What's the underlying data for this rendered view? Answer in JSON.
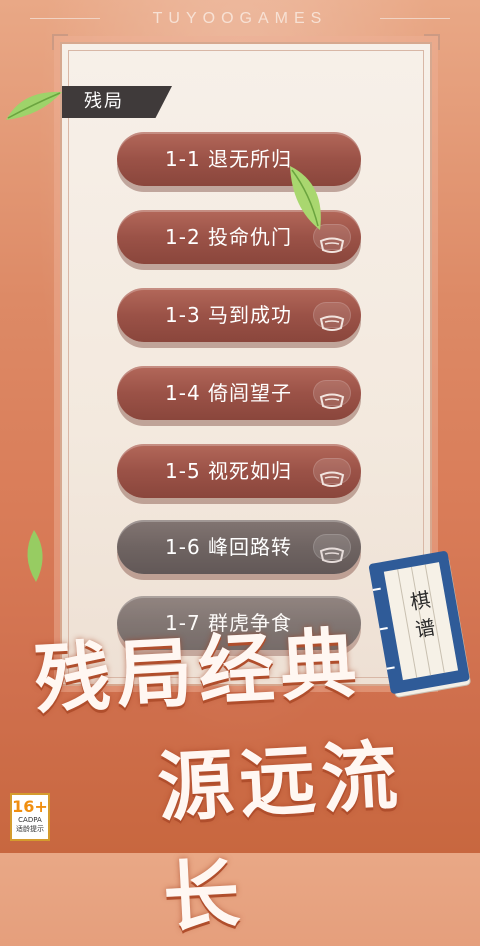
{
  "brand": "TUYOOGAMES",
  "section_tag": "残局",
  "levels": [
    {
      "label": "1-1 退无所归",
      "locked": false
    },
    {
      "label": "1-2 投命仇门",
      "locked": false
    },
    {
      "label": "1-3 马到成功",
      "locked": false
    },
    {
      "label": "1-4 倚闾望子",
      "locked": false
    },
    {
      "label": "1-5 视死如归",
      "locked": false
    },
    {
      "label": "1-6 峰回路转",
      "locked": true
    },
    {
      "label": "1-7 群虎争食",
      "locked": true
    }
  ],
  "slogan_line1": "残局经典",
  "slogan_line2": "源远流长",
  "book_title": "棋谱",
  "age_rating": {
    "number": "16+",
    "line1": "CADPA",
    "line2": "适龄提示"
  },
  "colors": {
    "accent": "#9b5247",
    "locked": "#6f6462",
    "tag_bg": "#3f3a3a"
  }
}
